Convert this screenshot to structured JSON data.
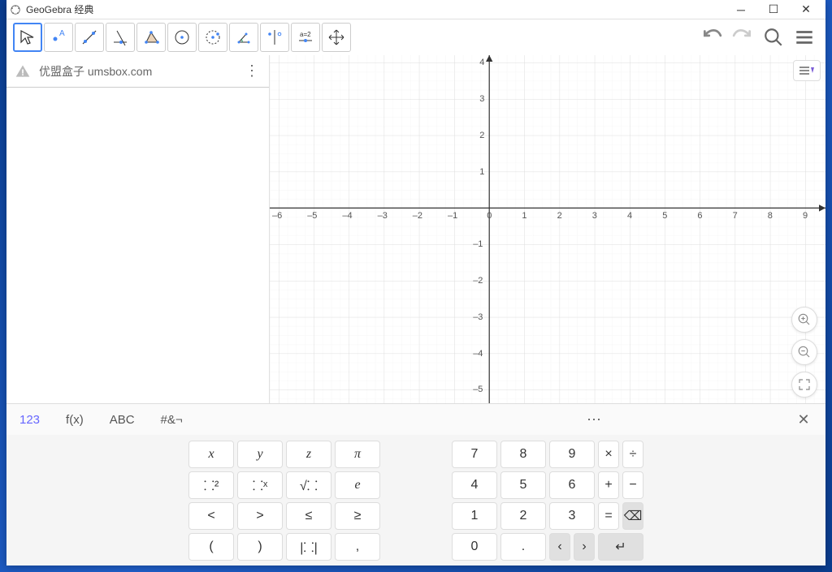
{
  "window": {
    "title": "GeoGebra 经典"
  },
  "input_row": {
    "text": "优盟盒子 umsbox.com"
  },
  "keyboard_tabs": {
    "t123": "123",
    "fx": "f(x)",
    "abc": "ABC",
    "sym": "#&¬"
  },
  "keys": {
    "x": "x",
    "y": "y",
    "z": "z",
    "pi": "π",
    "n7": "7",
    "n8": "8",
    "n9": "9",
    "mul": "×",
    "div": "÷",
    "sq": "⸬²",
    "pw": "⸬ˣ",
    "sqrt": "√⸬",
    "e": "e",
    "n4": "4",
    "n5": "5",
    "n6": "6",
    "plus": "+",
    "minus": "−",
    "lt": "<",
    "gt": ">",
    "le": "≤",
    "ge": "≥",
    "n1": "1",
    "n2": "2",
    "n3": "3",
    "eq": "=",
    "bksp": "⌫",
    "lp": "(",
    "rp": ")",
    "abs": "|⸬|",
    "comma": ",",
    "n0": "0",
    "dot": ".",
    "left": "‹",
    "right": "›",
    "enter": "↵"
  },
  "axis": {
    "x_ticks": [
      -6,
      -5,
      -4,
      -3,
      -2,
      -1,
      0,
      1,
      2,
      3,
      4,
      5,
      6,
      7,
      8,
      9
    ],
    "y_ticks": [
      4,
      3,
      2,
      1,
      -1,
      -2,
      -3,
      -4,
      -5
    ]
  }
}
